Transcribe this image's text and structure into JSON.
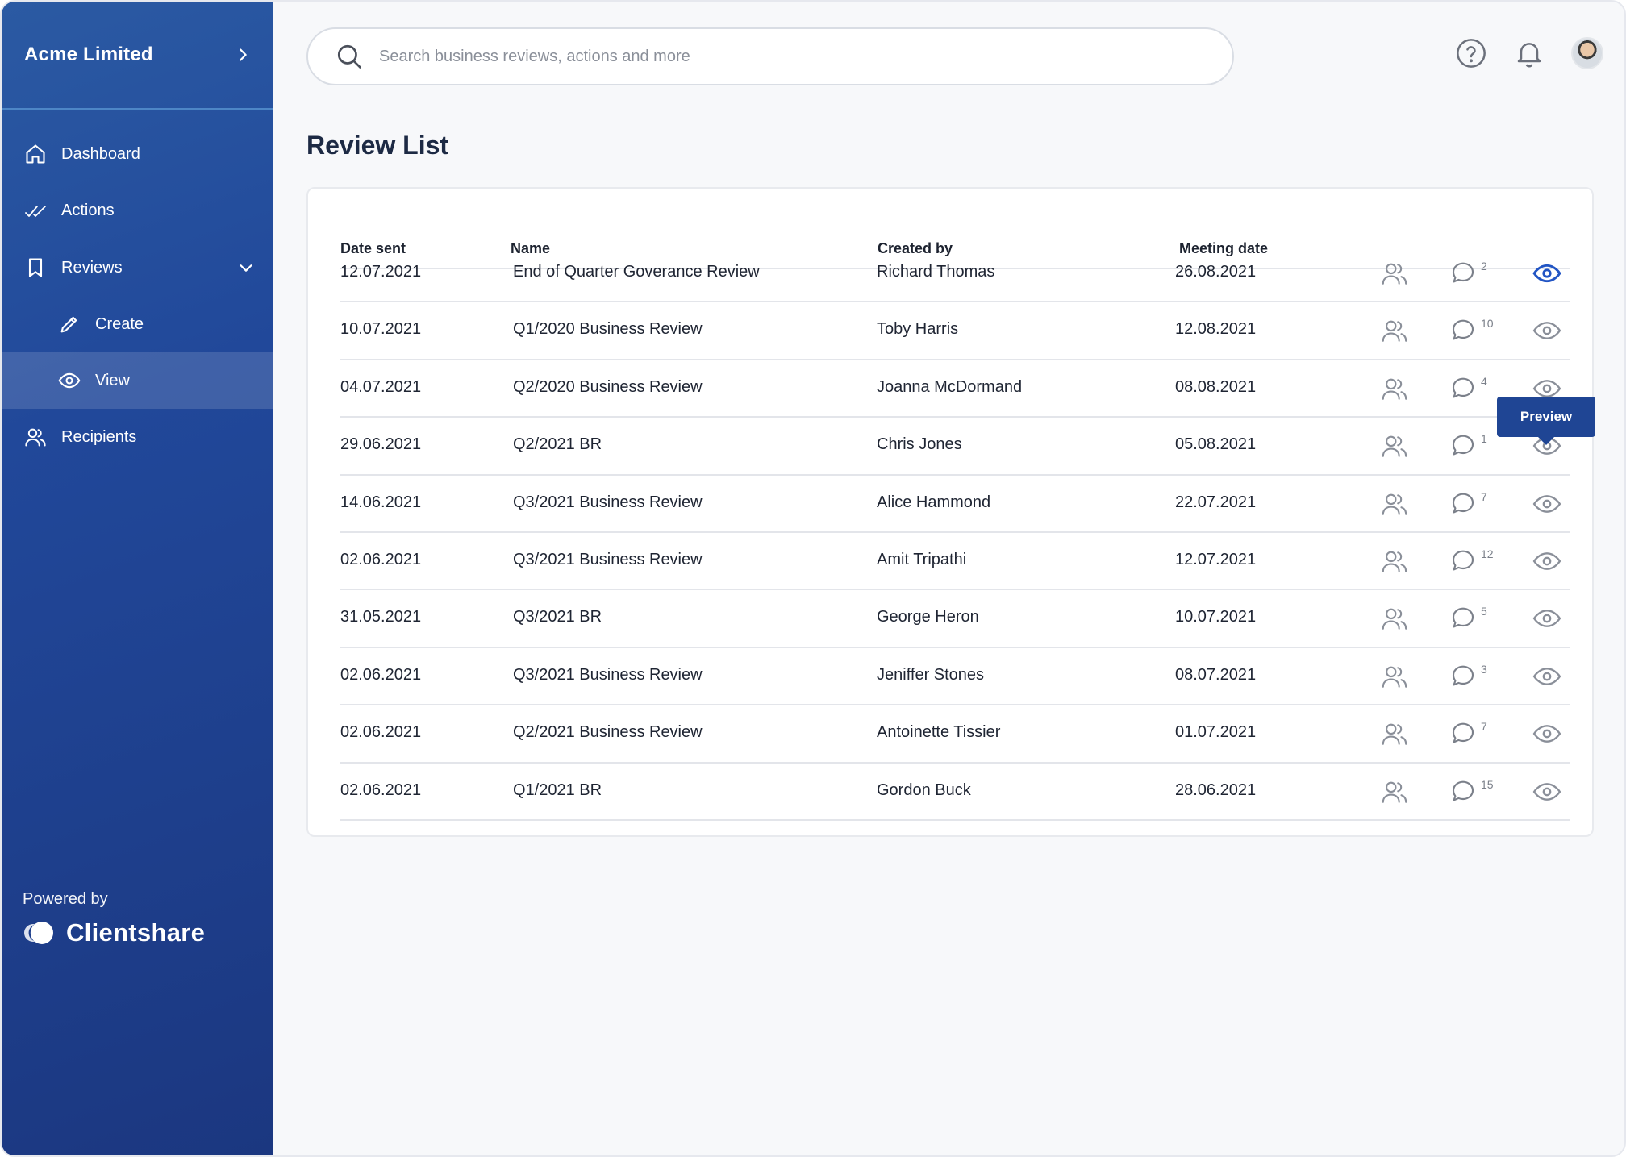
{
  "sidebar": {
    "org_name": "Acme Limited",
    "nav": {
      "dashboard": "Dashboard",
      "actions": "Actions",
      "reviews": "Reviews",
      "create": "Create",
      "view": "View",
      "recipients": "Recipients"
    },
    "powered_by": "Powered by",
    "brand": "Clientshare"
  },
  "search": {
    "placeholder": "Search business reviews, actions and more"
  },
  "page": {
    "title": "Review List"
  },
  "table": {
    "headers": {
      "date_sent": "Date sent",
      "name": "Name",
      "created_by": "Created by",
      "meeting_date": "Meeting date"
    },
    "tooltip": "Preview",
    "rows": [
      {
        "date_sent": "12.07.2021",
        "name": "End of Quarter Goverance Review",
        "created_by": "Richard Thomas",
        "meeting_date": "26.08.2021",
        "comments": "2"
      },
      {
        "date_sent": "10.07.2021",
        "name": "Q1/2020 Business Review",
        "created_by": "Toby Harris",
        "meeting_date": "12.08.2021",
        "comments": "10"
      },
      {
        "date_sent": "04.07.2021",
        "name": "Q2/2020 Business Review",
        "created_by": "Joanna McDormand",
        "meeting_date": "08.08.2021",
        "comments": "4"
      },
      {
        "date_sent": "29.06.2021",
        "name": "Q2/2021 BR",
        "created_by": "Chris Jones",
        "meeting_date": "05.08.2021",
        "comments": "1"
      },
      {
        "date_sent": "14.06.2021",
        "name": "Q3/2021 Business Review",
        "created_by": "Alice Hammond",
        "meeting_date": "22.07.2021",
        "comments": "7"
      },
      {
        "date_sent": "02.06.2021",
        "name": "Q3/2021 Business Review",
        "created_by": "Amit Tripathi",
        "meeting_date": "12.07.2021",
        "comments": "12"
      },
      {
        "date_sent": "31.05.2021",
        "name": "Q3/2021 BR",
        "created_by": "George Heron",
        "meeting_date": "10.07.2021",
        "comments": "5"
      },
      {
        "date_sent": "02.06.2021",
        "name": "Q3/2021 Business Review",
        "created_by": "Jeniffer Stones",
        "meeting_date": "08.07.2021",
        "comments": "3"
      },
      {
        "date_sent": "02.06.2021",
        "name": "Q2/2021 Business Review",
        "created_by": "Antoinette Tissier",
        "meeting_date": "01.07.2021",
        "comments": "7"
      },
      {
        "date_sent": "02.06.2021",
        "name": "Q1/2021 BR",
        "created_by": "Gordon Buck",
        "meeting_date": "28.06.2021",
        "comments": "15"
      }
    ]
  },
  "icons": {
    "search": "search-icon",
    "help": "help-circle-icon",
    "notifications": "bell-icon",
    "people": "users-icon",
    "comment": "comment-icon",
    "preview": "eye-icon"
  },
  "colors": {
    "sidebar_top": "#2b5aa3",
    "sidebar_bottom": "#1b3780",
    "accent": "#1f4594",
    "active_eye": "#2255c4",
    "icon_grey": "#8a8f99"
  }
}
